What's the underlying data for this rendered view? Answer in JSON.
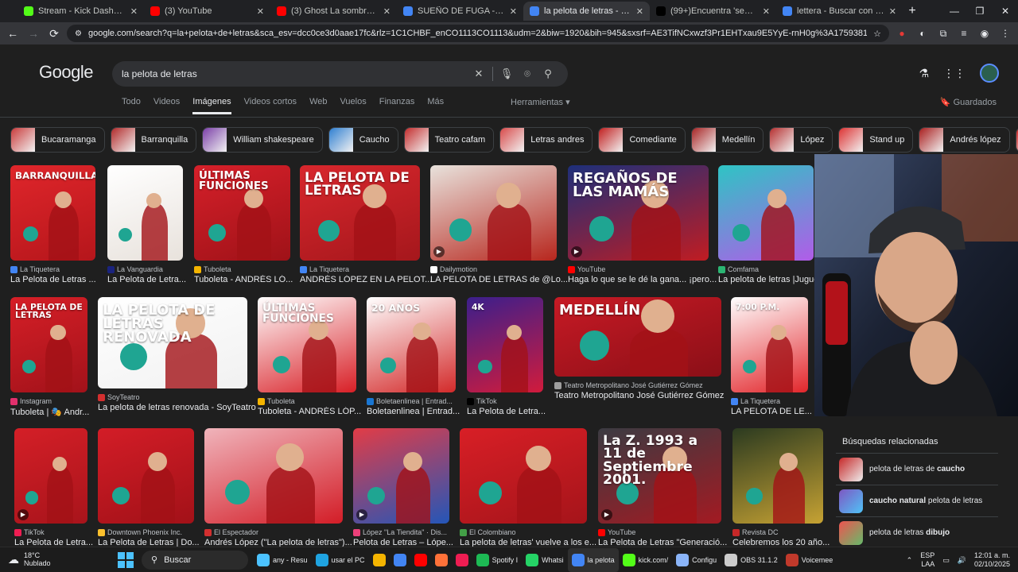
{
  "browser": {
    "tabs": [
      {
        "title": "Stream - Kick Dashboard",
        "favicon": "kick-icon",
        "color": "#53fc18"
      },
      {
        "title": "(3) YouTube",
        "favicon": "youtube-icon",
        "color": "#ff0000"
      },
      {
        "title": "(3) Ghost La sombra del amor",
        "favicon": "youtube-icon",
        "color": "#ff0000"
      },
      {
        "title": "SUEÑO DE FUGA - Buscar con",
        "favicon": "google-icon",
        "color": "#4285f4"
      },
      {
        "title": "la pelota de letras - Buscar con",
        "favicon": "google-icon",
        "color": "#4285f4",
        "active": true
      },
      {
        "title": "(99+)Encuentra 'segunda parte",
        "favicon": "tiktok-icon",
        "color": "#000000"
      },
      {
        "title": "lettera - Buscar con Google",
        "favicon": "google-icon",
        "color": "#4285f4"
      }
    ],
    "url": "google.com/search?q=la+pelota+de+letras&sca_esv=dcc0ce3d0aae17fc&rlz=1C1CHBF_enCO1113CO1113&udm=2&biw=1920&bih=945&sxsrf=AE3TifNCxwzf3Pr1EHTxau9E5YyE-rnH0g%3A1759381236535&ei=9AbeaKu5lLaXwbkPkL6f..."
  },
  "google": {
    "logo": "Google",
    "query": "la pelota de letras",
    "nav_tabs": [
      "Todo",
      "Videos",
      "Imágenes",
      "Videos cortos",
      "Web",
      "Vuelos",
      "Finanzas",
      "Más"
    ],
    "active_tab": "Imágenes",
    "tools_label": "Herramientas",
    "saved_label": "Guardados",
    "chips": [
      "Bucaramanga",
      "Barranquilla",
      "William shakespeare",
      "Caucho",
      "Teatro cafam",
      "Letras andres",
      "Comediante",
      "Medellín",
      "López",
      "Stand up",
      "Andrés lópez",
      "Comediant"
    ],
    "results": [
      {
        "source": "La Tiquetera",
        "title": "La Pelota de Letras ...",
        "overlay": "BARRANQUILLA"
      },
      {
        "source": "La Vanguardia",
        "title": "La Pelota de Letra..."
      },
      {
        "source": "Tuboleta",
        "title": "Tuboleta - ANDRÉS LÓ...",
        "overlay": "ÚLTIMAS FUNCIONES"
      },
      {
        "source": "La Tiquetera",
        "title": "ANDRÉS LÓPEZ EN LA PELOT...",
        "overlay": "LA PELOTA DE LETRAS"
      },
      {
        "source": "Dailymotion",
        "title": "LA PELOTA DE LETRAS de @Lo..."
      },
      {
        "source": "YouTube",
        "title": "Haga lo que se le dé la gana... ¡pero...",
        "overlay": "REGAÑOS DE LAS MAMÁS"
      },
      {
        "source": "Comfama",
        "title": "La pelota de letras |Juguete"
      },
      {
        "source": "Instagram",
        "title": "Tuboleta | 🎭 Andr...",
        "overlay": "LA PELOTA DE LETRAS"
      },
      {
        "source": "SoyTeatro",
        "title": "La pelota de letras renovada - SoyTeatro",
        "overlay": "LA PELOTA DE LETRAS RENOVADA"
      },
      {
        "source": "Tuboleta",
        "title": "Tuboleta - ANDRÉS LÓP...",
        "overlay": "ÚLTIMAS FUNCIONES"
      },
      {
        "source": "Boletaenlinea | Entrad...",
        "title": "Boletaenlinea | Entrad...",
        "overlay": "20 AÑOS"
      },
      {
        "source": "TikTok",
        "title": "La Pelota de Letra...",
        "overlay": "4K"
      },
      {
        "source": "Teatro Metropolitano José Gutiérrez Gómez",
        "title": "Teatro Metropolitano José Gutiérrez Gómez",
        "overlay": "MEDELLÍN"
      },
      {
        "source": "La Tiquetera",
        "title": "LA PELOTA DE LE...",
        "overlay": "7:00 P.M."
      },
      {
        "source": "TikTok",
        "title": "La Pelota de Letra..."
      },
      {
        "source": "Downtown Phoenix Inc.",
        "title": "La Pelota de Letras | Do..."
      },
      {
        "source": "El Espectador",
        "title": "Andrés López (\"La pelota de letras\")..."
      },
      {
        "source": "López \"La Tiendita\" · Dis...",
        "title": "Pelota de Letras – Lópe..."
      },
      {
        "source": "El Colombiano",
        "title": "La pelota de letras' vuelve a los e..."
      },
      {
        "source": "YouTube",
        "title": "La Pelota de Letras \"Generació...",
        "overlay": "La Z. 1993 a 11 de Septiembre 2001."
      },
      {
        "source": "Revista DC",
        "title": "Celebremos los 20 año..."
      }
    ],
    "related": {
      "heading": "Búsquedas relacionadas",
      "items": [
        {
          "prefix": "pelota de letras de ",
          "bold": "caucho",
          "suffix": ""
        },
        {
          "prefix": "",
          "bold": "caucho natural",
          "suffix": " pelota de letras"
        },
        {
          "prefix": "pelota de letras ",
          "bold": "dibujo",
          "suffix": ""
        }
      ]
    }
  },
  "taskbar": {
    "weather_temp": "18°C",
    "weather_desc": "Nublado",
    "search_label": "Buscar",
    "apps": [
      {
        "label": "any - Resu",
        "icon": "file-icon",
        "color": "#4cc2ff"
      },
      {
        "label": "usar el PC",
        "icon": "edge-icon",
        "color": "#1fa3e0"
      },
      {
        "label": "",
        "icon": "office-icon",
        "color": "#f4b400"
      },
      {
        "label": "",
        "icon": "chrome-icon",
        "color": "#4285f4"
      },
      {
        "label": "",
        "icon": "youtube-icon",
        "color": "#ff0000"
      },
      {
        "label": "",
        "icon": "firefox-icon",
        "color": "#ff7139"
      },
      {
        "label": "",
        "icon": "tiktok-icon",
        "color": "#ee1d52"
      },
      {
        "label": "Spotify I",
        "icon": "spotify-icon",
        "color": "#1db954"
      },
      {
        "label": "Whatsi",
        "icon": "whatsapp-icon",
        "color": "#25d366"
      },
      {
        "label": "la pelota",
        "icon": "chrome-icon",
        "color": "#4285f4",
        "active": true
      },
      {
        "label": "kick.com/",
        "icon": "kick-icon",
        "color": "#53fc18"
      },
      {
        "label": "Configu",
        "icon": "settings-icon",
        "color": "#8ab4f8"
      },
      {
        "label": "OBS 31.1.2",
        "icon": "obs-icon",
        "color": "#cccccc"
      },
      {
        "label": "Voicemee",
        "icon": "voicemeeter-icon",
        "color": "#c0392b"
      }
    ],
    "lang": "ESP",
    "lang_sub": "LAA",
    "time": "12:01 a. m.",
    "date": "02/10/2025"
  }
}
